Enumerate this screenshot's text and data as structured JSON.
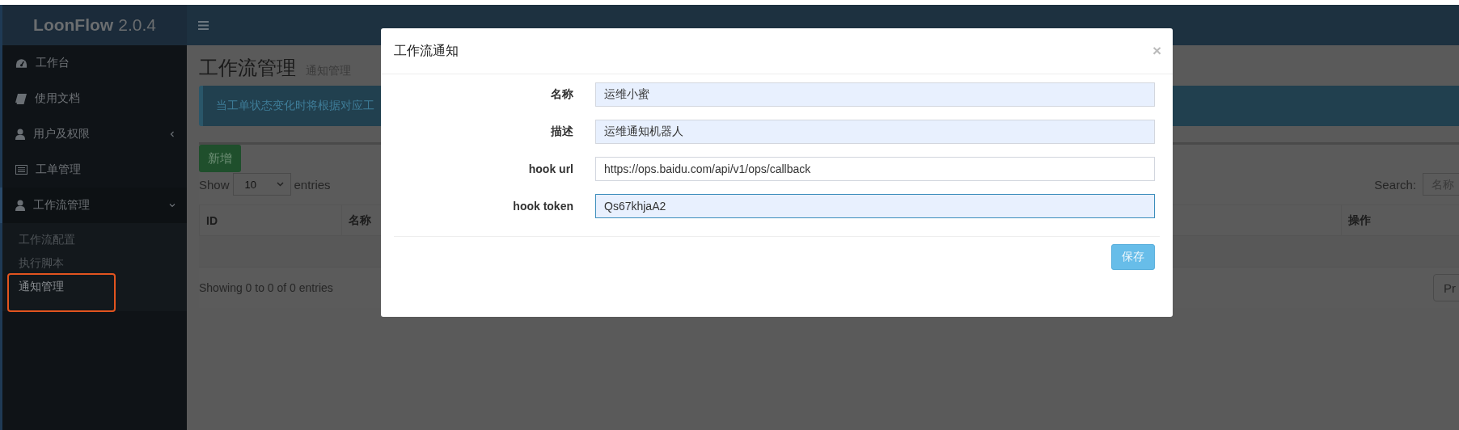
{
  "app": {
    "name": "LoonFlow",
    "version": "2.0.4"
  },
  "sidebar": {
    "items": [
      {
        "kind": "gauge",
        "label": "工作台",
        "selected": false
      },
      {
        "kind": "book",
        "label": "使用文档",
        "selected": false
      },
      {
        "kind": "user",
        "label": "用户及权限",
        "selected": false,
        "expanded": false
      },
      {
        "kind": "list",
        "label": "工单管理",
        "selected": false
      },
      {
        "kind": "user",
        "label": "工作流管理",
        "selected": true,
        "expanded": true,
        "children": [
          {
            "label": "工作流配置",
            "selected": false,
            "highlighted": false
          },
          {
            "label": "执行脚本",
            "selected": false,
            "highlighted": false
          },
          {
            "label": "通知管理",
            "selected": true,
            "highlighted": true
          }
        ]
      }
    ]
  },
  "page": {
    "title": "工作流管理",
    "subtitle": "通知管理"
  },
  "alert": {
    "text": "当工单状态变化时将根据对应工"
  },
  "add_button": "新增",
  "length_menu": {
    "prefix": "Show",
    "value": "10",
    "suffix": "entries"
  },
  "search": {
    "label": "Search:",
    "placeholder": "名称"
  },
  "table": {
    "columns": [
      "ID",
      "名称",
      "操作"
    ]
  },
  "info": "Showing 0 to 0 of 0 entries",
  "pagination": {
    "previous": "Pr"
  },
  "modal": {
    "title": "工作流通知",
    "close": "×",
    "fields": [
      {
        "label": "名称",
        "value": "运维小蜜",
        "autofilled": true,
        "focused": false
      },
      {
        "label": "描述",
        "value": "运维通知机器人",
        "autofilled": true,
        "focused": false
      },
      {
        "label": "hook url",
        "value": "https://ops.baidu.com/api/v1/ops/callback",
        "autofilled": false,
        "focused": false
      },
      {
        "label": "hook token",
        "value": "Qs67khjaA2",
        "autofilled": true,
        "focused": true
      }
    ],
    "save_button": "保存"
  }
}
